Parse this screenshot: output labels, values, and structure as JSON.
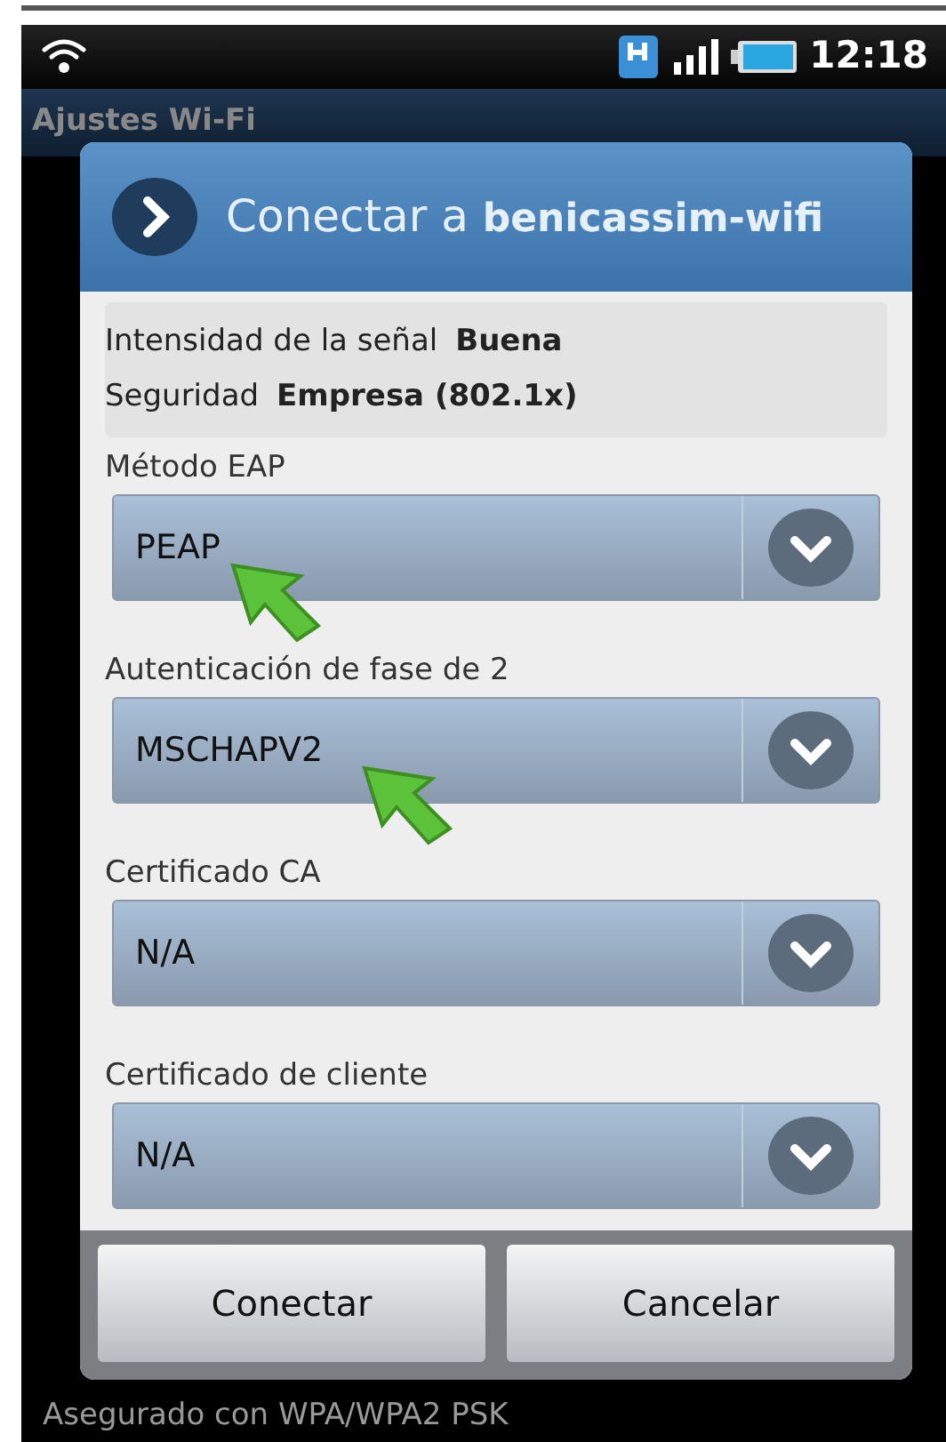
{
  "status_bar": {
    "time": "12:18"
  },
  "title_bar": {
    "title": "Ajustes Wi-Fi"
  },
  "dialog": {
    "title": "Conectar a",
    "network": "benicassim-wifi",
    "info": [
      {
        "label": "Intensidad de la señal",
        "value": "Buena"
      },
      {
        "label": "Seguridad",
        "value": "Empresa (802.1x)"
      }
    ],
    "fields": [
      {
        "label": "Método EAP",
        "value": "PEAP",
        "pointer": true
      },
      {
        "label": "Autenticación de fase de 2",
        "value": "MSCHAPV2",
        "pointer": true
      },
      {
        "label": "Certificado CA",
        "value": "N/A",
        "pointer": false
      },
      {
        "label": "Certificado de cliente",
        "value": "N/A",
        "pointer": false
      }
    ],
    "buttons": [
      "Conectar",
      "Cancelar"
    ]
  },
  "background_item": {
    "subtitle": "Asegurado con WPA/WPA2 PSK"
  }
}
